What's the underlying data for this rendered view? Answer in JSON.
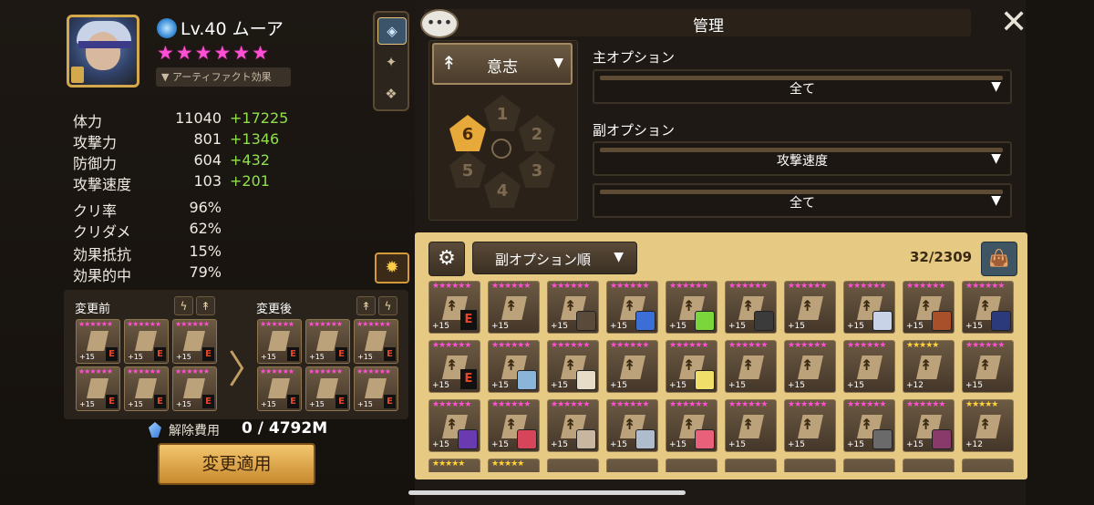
{
  "monster": {
    "level": "Lv.40",
    "name": "ムーア",
    "stars": "★★★★★★",
    "artifact_label": "▼ アーティファクト効果"
  },
  "stats": [
    {
      "label": "体力",
      "base": "11040",
      "bonus": "+17225"
    },
    {
      "label": "攻撃力",
      "base": "801",
      "bonus": "+1346"
    },
    {
      "label": "防御力",
      "base": "604",
      "bonus": "+432"
    },
    {
      "label": "攻撃速度",
      "base": "103",
      "bonus": "+201"
    },
    {
      "label": "クリ率",
      "base": "96%",
      "bonus": ""
    },
    {
      "label": "クリダメ",
      "base": "62%",
      "bonus": ""
    },
    {
      "label": "効果抵抗",
      "base": "15%",
      "bonus": ""
    },
    {
      "label": "効果的中",
      "base": "79%",
      "bonus": ""
    }
  ],
  "compare": {
    "before_label": "変更前",
    "after_label": "変更後",
    "plus": "+15",
    "e_mark": "E",
    "cost_label": "解除費用",
    "cost_value": "0 / 4792M",
    "apply_label": "変更適用"
  },
  "manager": {
    "title": "管理",
    "set_name": "意志",
    "slots": [
      "1",
      "2",
      "3",
      "4",
      "5",
      "6"
    ],
    "selected_slot": "6",
    "main_option_label": "主オプション",
    "main_option_value": "全て",
    "sub_option_label": "副オプション",
    "sub_option_value_1": "攻撃速度",
    "sub_option_value_2": "全て"
  },
  "inventory": {
    "sort_label": "副オプション順",
    "count": "32/2309",
    "rows": [
      [
        {
          "stars": "★★★★★★",
          "level": "+15",
          "e": true,
          "mon": ""
        },
        {
          "stars": "★★★★★★",
          "level": "+15",
          "e": false,
          "mon": ""
        },
        {
          "stars": "★★★★★★",
          "level": "+15",
          "e": false,
          "mon": "#5a4a3a"
        },
        {
          "stars": "★★★★★★",
          "level": "+15",
          "e": false,
          "mon": "#3b6fd6"
        },
        {
          "stars": "★★★★★★",
          "level": "+15",
          "e": false,
          "mon": "#7ad63b"
        },
        {
          "stars": "★★★★★★",
          "level": "+15",
          "e": false,
          "mon": "#3b3b3b"
        },
        {
          "stars": "★★★★★★",
          "level": "+15",
          "e": false,
          "mon": ""
        },
        {
          "stars": "★★★★★★",
          "level": "+15",
          "e": false,
          "mon": "#c9d3e8"
        },
        {
          "stars": "★★★★★★",
          "level": "+15",
          "e": false,
          "mon": "#a8502a"
        },
        {
          "stars": "★★★★★★",
          "level": "+15",
          "e": false,
          "mon": "#2a3a7a"
        }
      ],
      [
        {
          "stars": "★★★★★★",
          "level": "+15",
          "e": true,
          "mon": ""
        },
        {
          "stars": "★★★★★★",
          "level": "+15",
          "e": false,
          "mon": "#8ab4d8"
        },
        {
          "stars": "★★★★★★",
          "level": "+15",
          "e": false,
          "mon": "#e6dcc8"
        },
        {
          "stars": "★★★★★★",
          "level": "+15",
          "e": false,
          "mon": ""
        },
        {
          "stars": "★★★★★★",
          "level": "+15",
          "e": false,
          "mon": "#f0e06a"
        },
        {
          "stars": "★★★★★★",
          "level": "+15",
          "e": false,
          "mon": ""
        },
        {
          "stars": "★★★★★★",
          "level": "+15",
          "e": false,
          "mon": ""
        },
        {
          "stars": "★★★★★★",
          "level": "+15",
          "e": false,
          "mon": ""
        },
        {
          "stars": "★★★★★",
          "level": "+12",
          "e": false,
          "mon": ""
        },
        {
          "stars": "★★★★★★",
          "level": "+15",
          "e": false,
          "mon": ""
        }
      ],
      [
        {
          "stars": "★★★★★★",
          "level": "+15",
          "e": false,
          "mon": "#6a3bb0"
        },
        {
          "stars": "★★★★★★",
          "level": "+15",
          "e": false,
          "mon": "#d6455a"
        },
        {
          "stars": "★★★★★★",
          "level": "+15",
          "e": false,
          "mon": "#c8b6a0"
        },
        {
          "stars": "★★★★★★",
          "level": "+15",
          "e": false,
          "mon": "#aebccc"
        },
        {
          "stars": "★★★★★★",
          "level": "+15",
          "e": false,
          "mon": "#e8607a"
        },
        {
          "stars": "★★★★★★",
          "level": "+15",
          "e": false,
          "mon": ""
        },
        {
          "stars": "★★★★★★",
          "level": "+15",
          "e": false,
          "mon": ""
        },
        {
          "stars": "★★★★★★",
          "level": "+15",
          "e": false,
          "mon": "#6a6a6a"
        },
        {
          "stars": "★★★★★★",
          "level": "+15",
          "e": false,
          "mon": "#8a3a6a"
        },
        {
          "stars": "★★★★★",
          "level": "+12",
          "e": false,
          "mon": ""
        }
      ]
    ]
  },
  "colors": {
    "six_star": "#ff4fd2",
    "five_star": "#ffd23a",
    "bonus_green": "#8fe04a",
    "panel_gold": "#e6c983"
  }
}
